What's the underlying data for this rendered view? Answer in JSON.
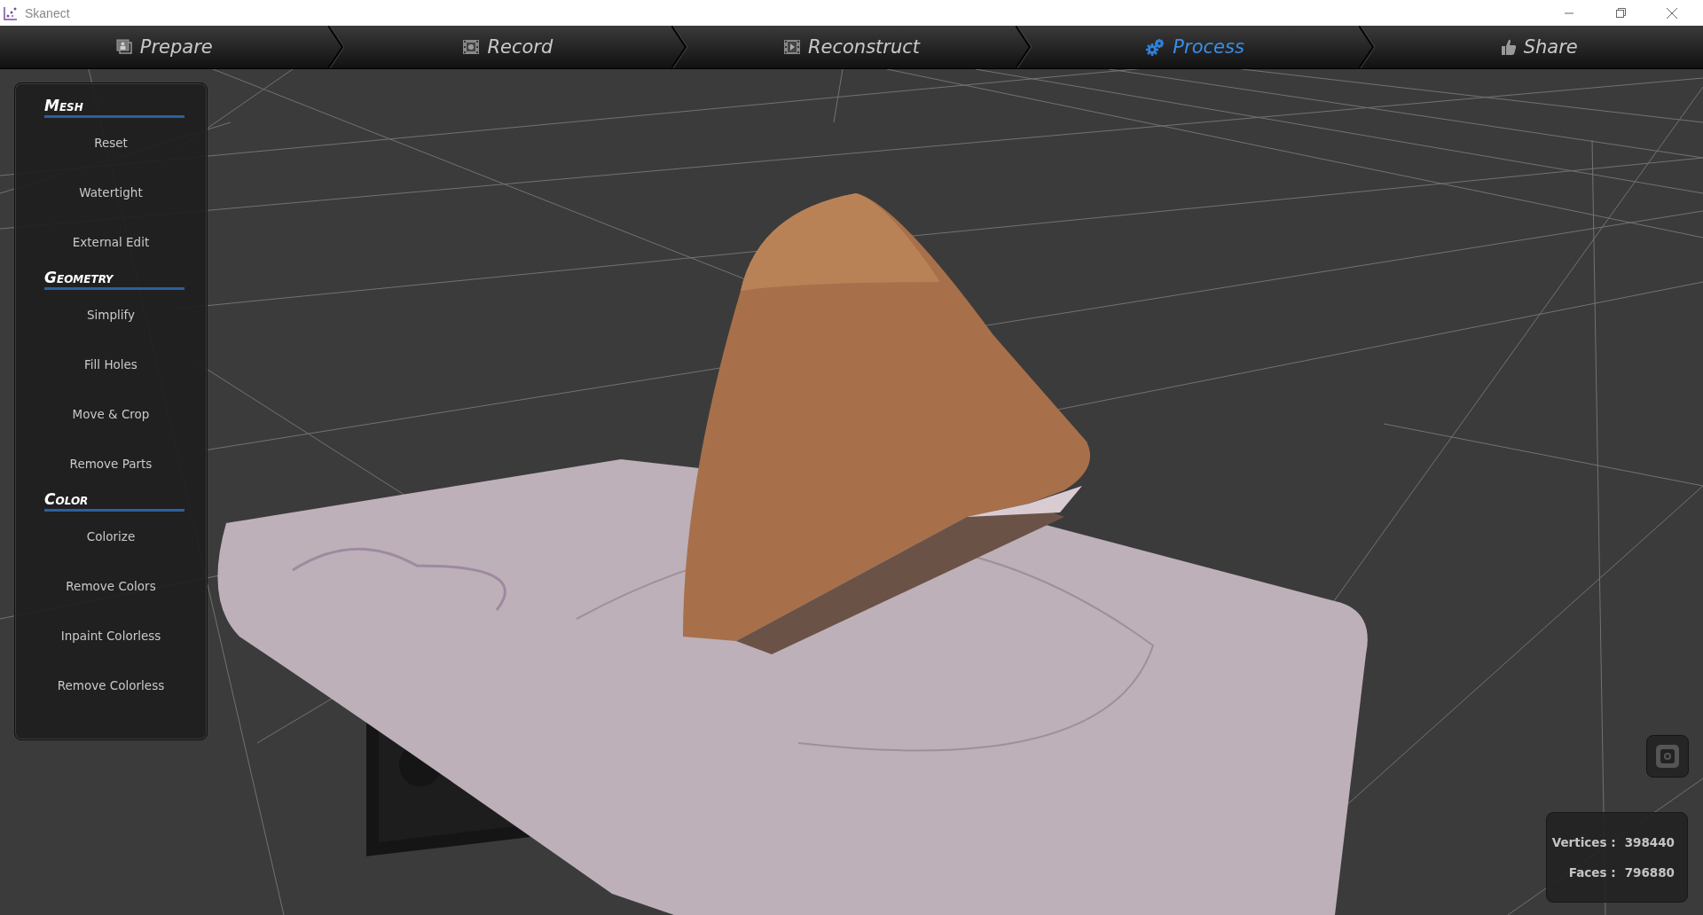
{
  "window": {
    "title": "Skanect"
  },
  "tabs": [
    {
      "label": "Prepare",
      "selected": false
    },
    {
      "label": "Record",
      "selected": false
    },
    {
      "label": "Reconstruct",
      "selected": false
    },
    {
      "label": "Process",
      "selected": true
    },
    {
      "label": "Share",
      "selected": false
    }
  ],
  "sidebar": {
    "sections": [
      {
        "heading": "Mesh",
        "items": [
          "Reset",
          "Watertight",
          "External Edit"
        ]
      },
      {
        "heading": "Geometry",
        "items": [
          "Simplify",
          "Fill Holes",
          "Move & Crop",
          "Remove Parts"
        ]
      },
      {
        "heading": "Color",
        "items": [
          "Colorize",
          "Remove Colors",
          "Inpaint Colorless",
          "Remove Colorless"
        ]
      }
    ]
  },
  "stats": [
    {
      "label": "Vertices :",
      "value": "398440"
    },
    {
      "label": "Faces :",
      "value": "796880"
    }
  ]
}
